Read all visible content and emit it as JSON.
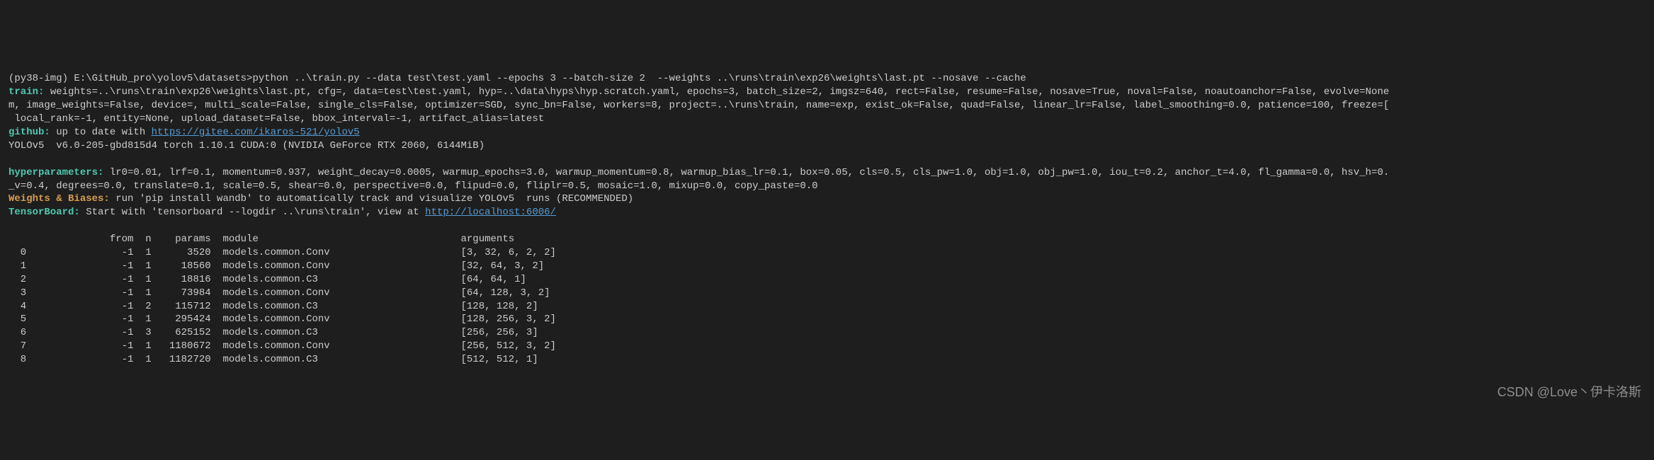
{
  "prompt": "(py38-img) E:\\GitHub_pro\\yolov5\\datasets>python ..\\train.py --data test\\test.yaml --epochs 3 --batch-size 2  --weights ..\\runs\\train\\exp26\\weights\\last.pt --nosave --cache",
  "labels": {
    "train": "train:",
    "github": "github:",
    "hyperparameters": "hyperparameters:",
    "weights_biases": "Weights & Biases:",
    "tensorboard": "TensorBoard:"
  },
  "train_text": " weights=..\\runs\\train\\exp26\\weights\\last.pt, cfg=, data=test\\test.yaml, hyp=..\\data\\hyps\\hyp.scratch.yaml, epochs=3, batch_size=2, imgsz=640, rect=False, resume=False, nosave=True, noval=False, noautoanchor=False, evolve=None\nm, image_weights=False, device=, multi_scale=False, single_cls=False, optimizer=SGD, sync_bn=False, workers=8, project=..\\runs\\train, name=exp, exist_ok=False, quad=False, linear_lr=False, label_smoothing=0.0, patience=100, freeze=[\n local_rank=-1, entity=None, upload_dataset=False, bbox_interval=-1, artifact_alias=latest",
  "github_text": " up to date with ",
  "github_link": "https://gitee.com/ikaros-521/yolov5",
  "yolov5_line": "YOLOv5  v6.0-205-gbd815d4 torch 1.10.1 CUDA:0 (NVIDIA GeForce RTX 2060, 6144MiB)",
  "hyperparameters_text": " lr0=0.01, lrf=0.1, momentum=0.937, weight_decay=0.0005, warmup_epochs=3.0, warmup_momentum=0.8, warmup_bias_lr=0.1, box=0.05, cls=0.5, cls_pw=1.0, obj=1.0, obj_pw=1.0, iou_t=0.2, anchor_t=4.0, fl_gamma=0.0, hsv_h=0.\n_v=0.4, degrees=0.0, translate=0.1, scale=0.5, shear=0.0, perspective=0.0, flipud=0.0, fliplr=0.5, mosaic=1.0, mixup=0.0, copy_paste=0.0",
  "weights_biases_text": " run 'pip install wandb' to automatically track and visualize YOLOv5  runs (RECOMMENDED)",
  "tensorboard_text": " Start with 'tensorboard --logdir ..\\runs\\train', view at ",
  "tensorboard_link": "http://localhost:6006/",
  "table": {
    "header": "                 from  n    params  module                                  arguments",
    "rows": [
      "  0                -1  1      3520  models.common.Conv                      [3, 32, 6, 2, 2]",
      "  1                -1  1     18560  models.common.Conv                      [32, 64, 3, 2]",
      "  2                -1  1     18816  models.common.C3                        [64, 64, 1]",
      "  3                -1  1     73984  models.common.Conv                      [64, 128, 3, 2]",
      "  4                -1  2    115712  models.common.C3                        [128, 128, 2]",
      "  5                -1  1    295424  models.common.Conv                      [128, 256, 3, 2]",
      "  6                -1  3    625152  models.common.C3                        [256, 256, 3]",
      "  7                -1  1   1180672  models.common.Conv                      [256, 512, 3, 2]",
      "  8                -1  1   1182720  models.common.C3                        [512, 512, 1]"
    ]
  },
  "watermark": "CSDN @Love丶伊卡洛斯"
}
